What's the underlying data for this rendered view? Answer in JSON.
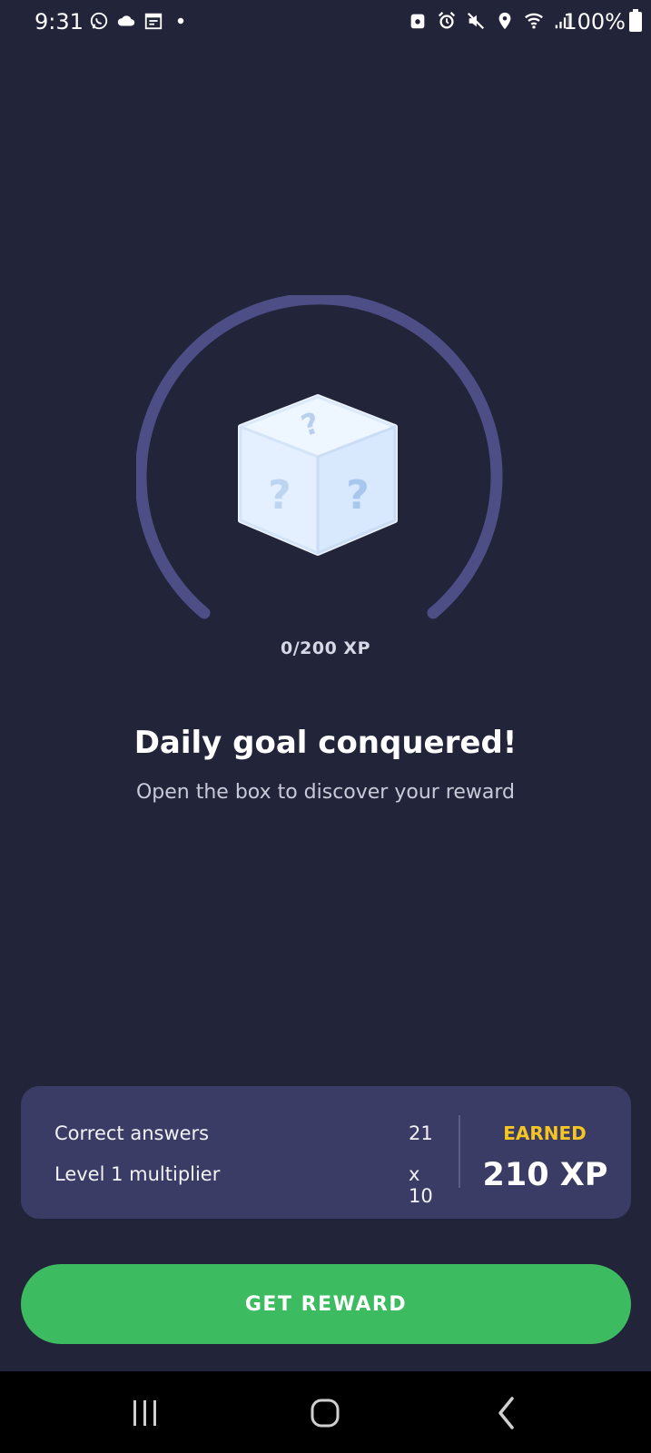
{
  "status_bar": {
    "time": "9:31",
    "battery": "100%",
    "left_icons": [
      "whatsapp-icon",
      "cloud-icon",
      "calendar-icon",
      "dot-icon"
    ],
    "right_icons": [
      "photo-icon",
      "alarm-icon",
      "mute-icon",
      "location-icon",
      "wifi-icon",
      "signal-icon"
    ]
  },
  "goal": {
    "progress_text": "0/200 XP",
    "title": "Daily goal conquered!",
    "subtitle": "Open the box to discover your reward",
    "box_icon": "mystery-box-icon",
    "ring_color": "#4e4e86"
  },
  "stats": {
    "rows": [
      {
        "label": "Correct answers",
        "value": "21"
      },
      {
        "label": "Level 1 multiplier",
        "value": "x 10"
      }
    ],
    "earned_label": "EARNED",
    "earned_value": "210 XP",
    "earned_color": "#f5c623"
  },
  "button": {
    "label": "GET REWARD",
    "color": "#3dbb60"
  },
  "nav": {
    "items": [
      "recent-apps-icon",
      "home-icon",
      "back-icon"
    ]
  }
}
